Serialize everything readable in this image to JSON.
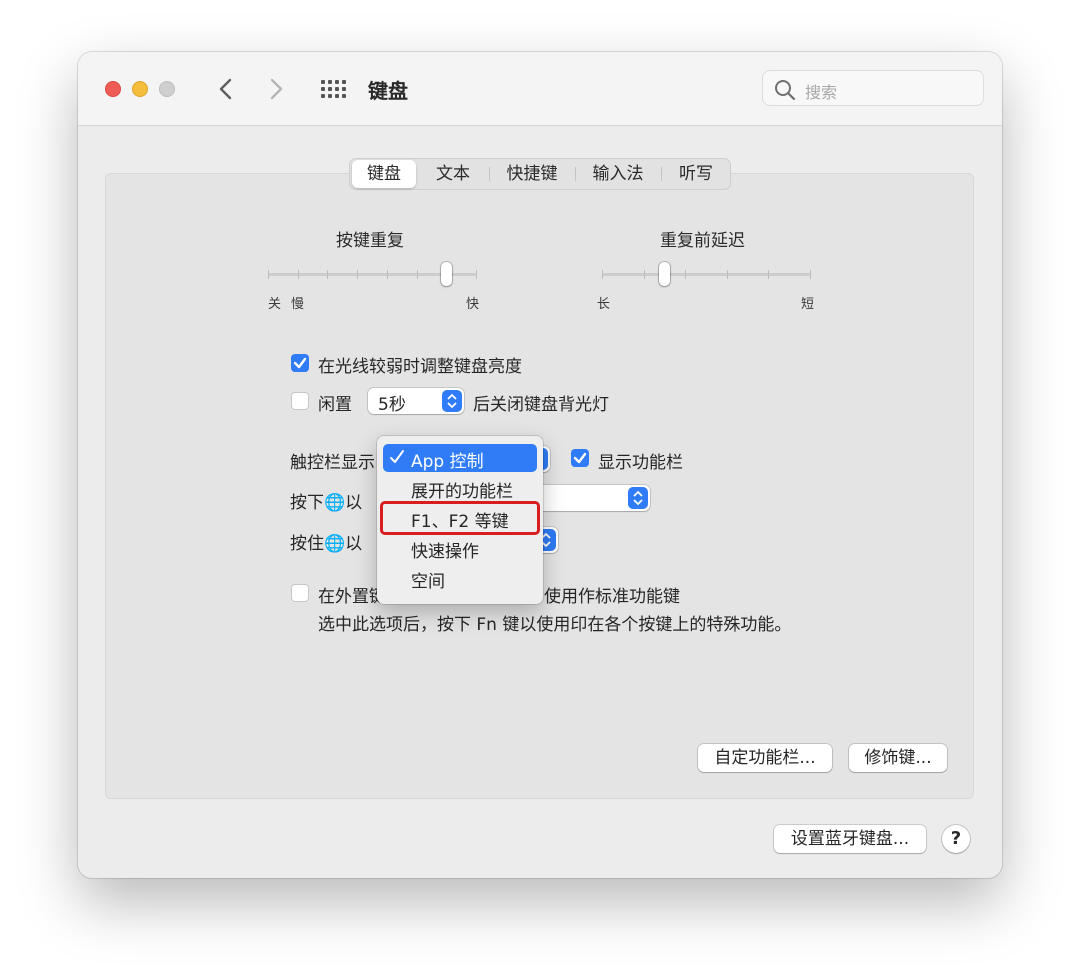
{
  "window": {
    "title": "键盘",
    "search_placeholder": "搜索"
  },
  "tabs": [
    {
      "label": "键盘",
      "selected": true
    },
    {
      "label": "文本",
      "selected": false
    },
    {
      "label": "快捷键",
      "selected": false
    },
    {
      "label": "输入法",
      "selected": false
    },
    {
      "label": "听写",
      "selected": false
    }
  ],
  "key_repeat": {
    "title": "按键重复",
    "labels": {
      "off": "关",
      "slow": "慢",
      "fast": "快"
    },
    "tick_count": 8,
    "value_step": 6
  },
  "repeat_delay": {
    "title": "重复前延迟",
    "labels": {
      "long": "长",
      "short": "短"
    },
    "tick_count": 6,
    "value_step": 1.5
  },
  "options": {
    "adjust_brightness": {
      "label": "在光线较弱时调整键盘亮度",
      "checked": true
    },
    "idle": {
      "prefix": "闲置",
      "value": "5秒",
      "suffix": "后关闭键盘背光灯",
      "checked": false
    },
    "touchbar_label": "触控栏显示",
    "show_function_bar": {
      "label": "显示功能栏",
      "checked": true
    },
    "press_label": "按下🌐以",
    "hold_label": "按住🌐以",
    "external_keyboard": {
      "label_left": "在外置键",
      "label_right": "使用作标准功能键",
      "checked": false
    },
    "hint": "选中此选项后，按下 Fn 键以使用印在各个按键上的特殊功能。"
  },
  "dropdown_menu": {
    "items": [
      {
        "label": "App 控制",
        "selected": true
      },
      {
        "label": "展开的功能栏",
        "selected": false
      },
      {
        "label": "F1、F2 等键",
        "selected": false,
        "highlighted": true
      },
      {
        "label": "快速操作",
        "selected": false
      },
      {
        "label": "空间",
        "selected": false
      }
    ]
  },
  "buttons": {
    "customize_control_strip": "自定功能栏...",
    "modifier_keys": "修饰键...",
    "setup_bluetooth": "设置蓝牙键盘...",
    "help": "?"
  },
  "colors": {
    "accent": "#2f7cf6",
    "highlight_border": "#d81e1e",
    "close": "#ee5c55",
    "minimize": "#f4bd3c"
  }
}
